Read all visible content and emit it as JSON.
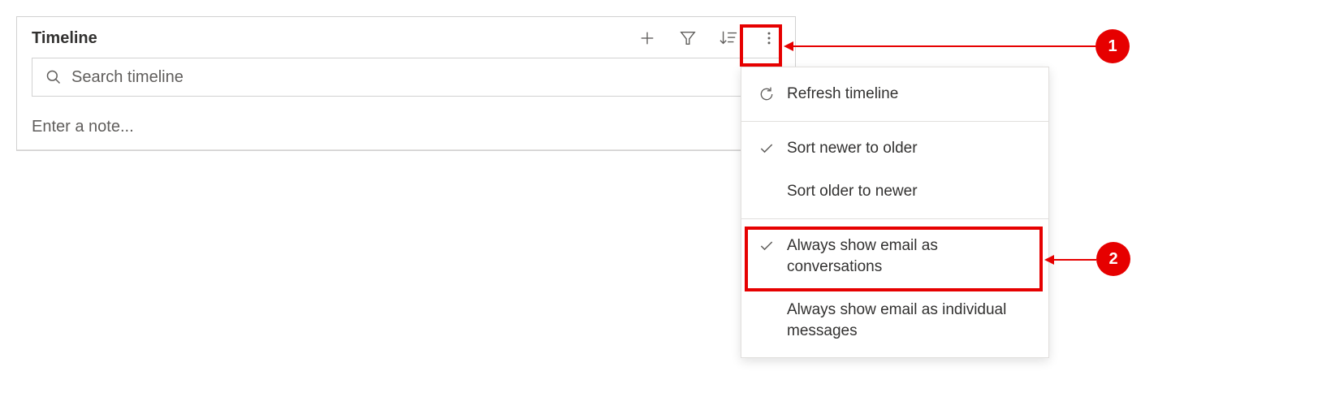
{
  "timeline": {
    "title": "Timeline",
    "search_placeholder": "Search timeline",
    "note_placeholder": "Enter a note..."
  },
  "toolbar": {
    "add": "Add",
    "filter": "Filter",
    "sort": "Sort",
    "more": "More"
  },
  "dropdown": {
    "refresh": "Refresh timeline",
    "sort_newer": "Sort newer to older",
    "sort_older": "Sort older to newer",
    "email_conv": "Always show email as conversations",
    "email_indiv": "Always show email as individual messages"
  },
  "callouts": {
    "one": "1",
    "two": "2"
  }
}
